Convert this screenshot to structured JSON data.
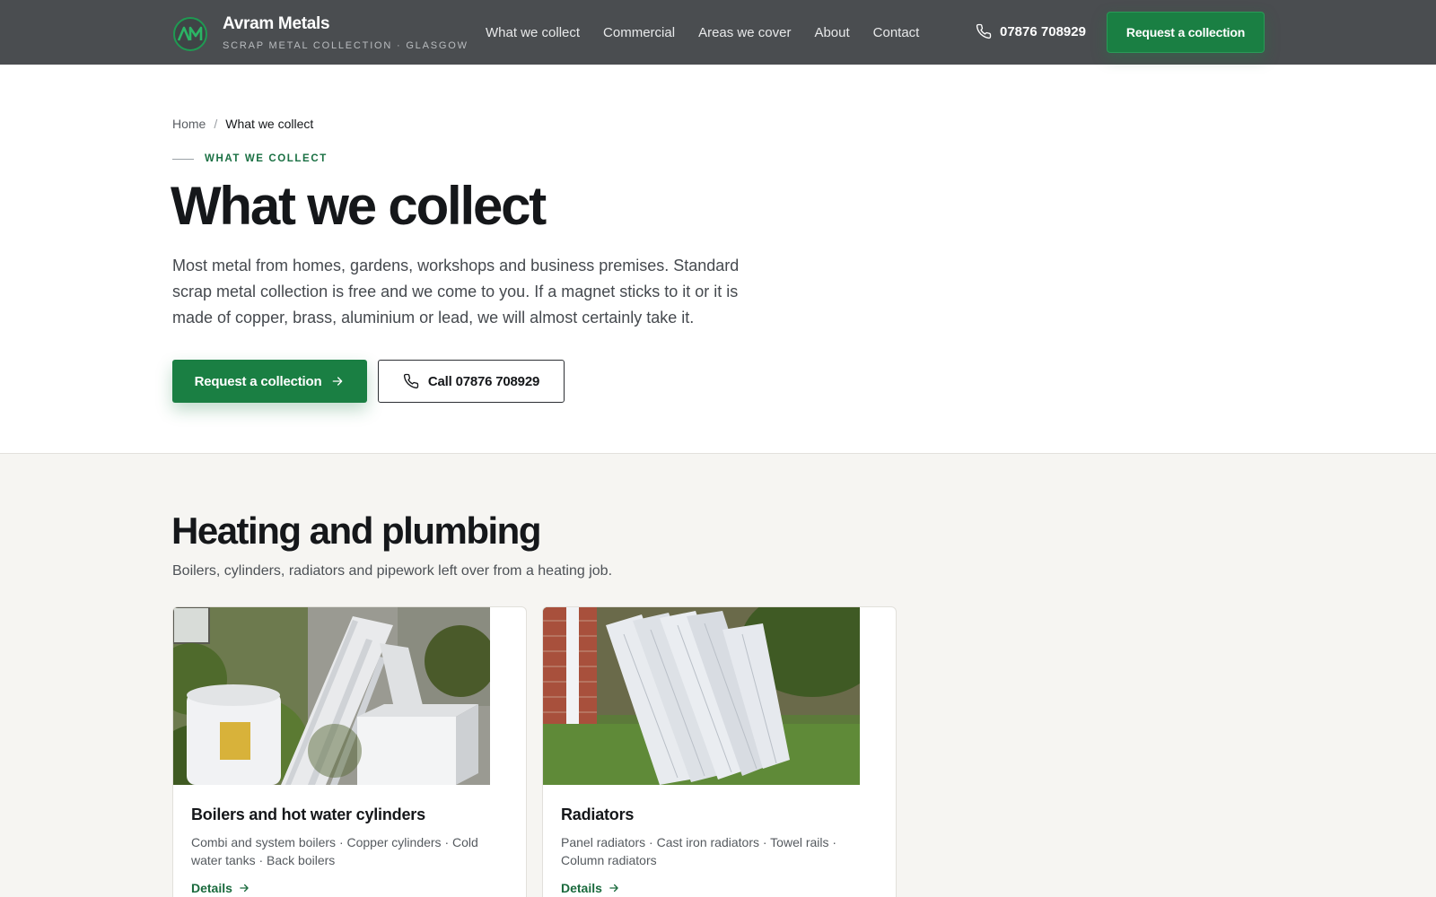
{
  "header": {
    "brand_name": "Avram Metals",
    "brand_tagline": "SCRAP METAL COLLECTION · GLASGOW",
    "logo_icon": "am-monogram-logo",
    "nav": [
      {
        "label": "What we collect"
      },
      {
        "label": "Commercial"
      },
      {
        "label": "Areas we cover"
      },
      {
        "label": "About"
      },
      {
        "label": "Contact"
      }
    ],
    "phone": "07876 708929",
    "phone_icon": "phone-icon",
    "cta_label": "Request a collection"
  },
  "breadcrumb": {
    "home": "Home",
    "separator": "/",
    "current": "What we collect"
  },
  "hero": {
    "eyebrow": "WHAT WE COLLECT",
    "title": "What we collect",
    "text": "Most metal from homes, gardens, workshops and business premises. Standard scrap metal collection is free and we come to you. If a magnet sticks to it or it is made of copper, brass, aluminium or lead, we will almost certainly take it.",
    "primary_label": "Request a collection",
    "secondary_label": "Call 07876 708929"
  },
  "section": {
    "title": "Heating and plumbing",
    "text": "Boilers, cylinders, radiators and pipework left over from a heating job.",
    "cards": [
      {
        "title": "Boilers and hot water cylinders",
        "desc": "Combi and system boilers · Copper cylinders · Cold water tanks · Back boilers",
        "link": "Details"
      },
      {
        "title": "Radiators",
        "desc": "Panel radiators · Cast iron radiators · Towel rails · Column radiators",
        "link": "Details"
      }
    ]
  },
  "colors": {
    "header_bg": "#4a4d50",
    "accent_green": "#1a7f43",
    "section_bg": "#f6f5f2",
    "text_dark": "#15171a"
  }
}
